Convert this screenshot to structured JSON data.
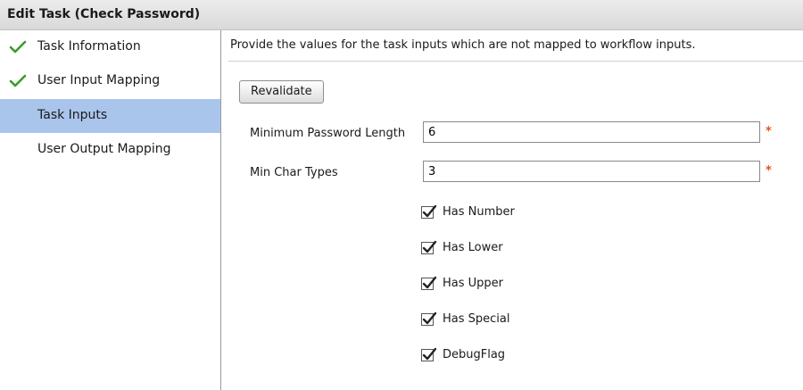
{
  "window": {
    "title": "Edit Task (Check Password)"
  },
  "sidebar": {
    "items": [
      {
        "label": "Task Information",
        "completed": true,
        "active": false
      },
      {
        "label": "User Input Mapping",
        "completed": true,
        "active": false
      },
      {
        "label": "Task Inputs",
        "completed": false,
        "active": true
      },
      {
        "label": "User Output Mapping",
        "completed": false,
        "active": false
      }
    ]
  },
  "main": {
    "intro_text": "Provide the values for the task inputs which are not mapped to workflow inputs.",
    "revalidate_label": "Revalidate",
    "fields": [
      {
        "label": "Minimum Password Length",
        "value": "6",
        "required": true,
        "required_marker": "*"
      },
      {
        "label": "Min Char Types",
        "value": "3",
        "required": true,
        "required_marker": "*"
      }
    ],
    "checkboxes": [
      {
        "label": "Has Number",
        "checked": true
      },
      {
        "label": "Has Lower",
        "checked": true
      },
      {
        "label": "Has Upper",
        "checked": true
      },
      {
        "label": "Has Special",
        "checked": true
      },
      {
        "label": "DebugFlag",
        "checked": true
      }
    ]
  },
  "colors": {
    "active_item_bg": "#a9c5ec",
    "check_green": "#3a9a2a",
    "required_asterisk": "#e8501a"
  },
  "icons": {
    "completed": "green-checkmark-icon",
    "checkbox_checked": "checkbox-checked-icon"
  }
}
